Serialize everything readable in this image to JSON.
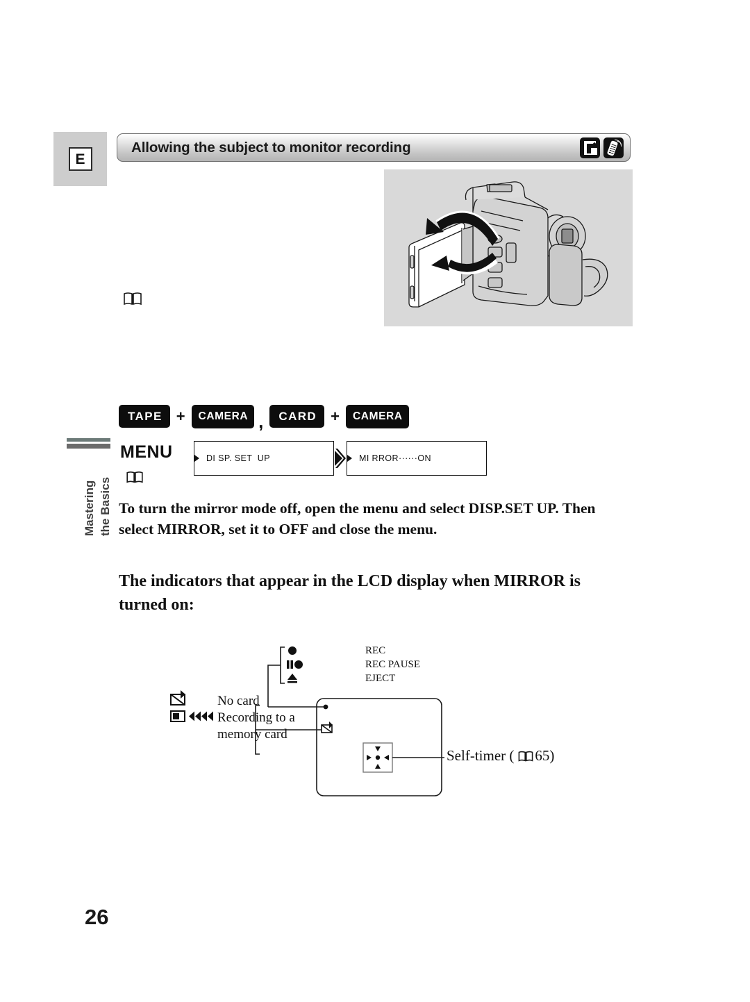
{
  "page": {
    "number": "26",
    "section_letter": "E"
  },
  "header": {
    "title": "Allowing the subject to monitor recording",
    "icons": [
      {
        "name": "memory-card-icon",
        "label": "memory card"
      },
      {
        "name": "wireless-controller-icon",
        "label": "wireless controller"
      }
    ]
  },
  "illustration": {
    "caption": "Camcorder with LCD panel rotated 180 degrees toward the subject"
  },
  "sidebar": {
    "line1": "Mastering",
    "line2": "the Basics"
  },
  "mode_row": {
    "chips": [
      {
        "label": "TAPE",
        "size": "large"
      },
      {
        "label": "CAMERA",
        "size": "small"
      },
      {
        "label": "CARD",
        "size": "large"
      },
      {
        "label": "CAMERA",
        "size": "small"
      }
    ],
    "plus": "+",
    "comma": ","
  },
  "menu": {
    "word": "MENU",
    "box1": "DI SP. SET  UP",
    "box2": "MI RROR······ON"
  },
  "paragraphs": {
    "p1": "To turn the mirror mode off, open the menu and select DISP.SET UP. Then select MIRROR, set it to OFF and close the menu.",
    "p2": "The indicators that appear in the LCD display when MIRROR is turned on:"
  },
  "lcd_diagram": {
    "top_labels": [
      "REC",
      "REC PAUSE",
      "EJECT"
    ],
    "left_labels": [
      "No card",
      "Recording to a",
      "memory card"
    ],
    "self_timer_label": "Self-timer (",
    "self_timer_page": "65)",
    "icons": {
      "rec": "record-dot-icon",
      "rec_pause": "record-pause-icon",
      "eject": "eject-icon",
      "no_card": "no-card-icon",
      "card_writing": "card-writing-icon",
      "self_timer": "self-timer-icon"
    }
  },
  "colors": {
    "tab_background": "#cdcdcd",
    "header_bar_top": "#ededed",
    "header_bar_bottom": "#b4b4b4",
    "illustration_background": "#d9d9d9",
    "sidebar_bar1": "#6c7a78",
    "sidebar_bar2": "#6b6b6b",
    "chip_background": "#0d0d0d",
    "ink": "#111111"
  }
}
